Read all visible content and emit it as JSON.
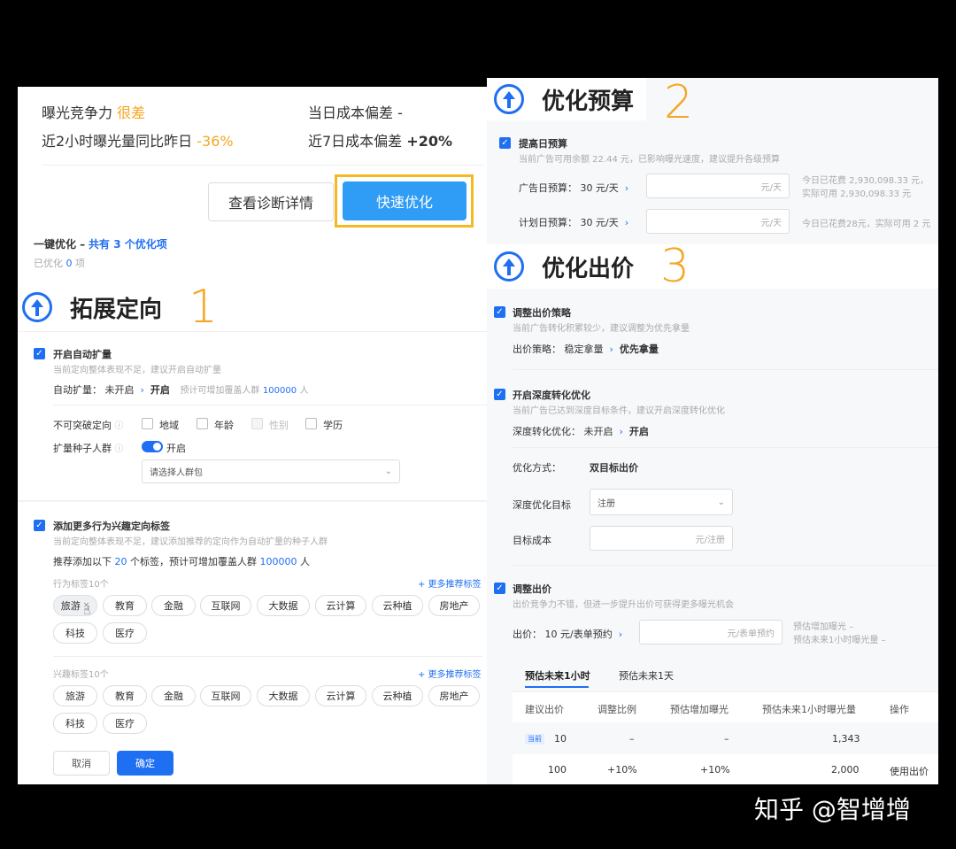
{
  "top_panel": {
    "exposure_label": "曝光竞争力",
    "exposure_value": "很差",
    "cost_dev_label": "当日成本偏差",
    "cost_dev_value": "-",
    "exposure_2h_label": "近2小时曝光量同比昨日",
    "exposure_2h_value": "-36%",
    "cost_7d_label": "近7日成本偏差",
    "cost_7d_value": "+20%",
    "detail_button": "查看诊断详情",
    "quick_button": "快速优化",
    "one_click_label": "一键优化 –",
    "one_click_count": "共有 3 个优化项",
    "optimized_prefix": "已优化",
    "optimized_count": "0",
    "optimized_suffix": "项"
  },
  "section1": {
    "title": "拓展定向",
    "number": "1",
    "auto_expand_title": "开启自动扩量",
    "auto_expand_desc": "当前定向整体表现不足，建议开启自动扩量",
    "auto_expand_label": "自动扩量：",
    "auto_expand_from": "未开启",
    "auto_expand_to": "开启",
    "auto_expand_est_prefix": "预计可增加覆盖人群",
    "auto_expand_est_value": "100000",
    "auto_expand_est_suffix": "人",
    "unbreakable_label": "不可突破定向",
    "unbreak_options": [
      "地域",
      "年龄",
      "性别",
      "学历"
    ],
    "seed_label": "扩量种子人群",
    "seed_toggle": "开启",
    "seed_select_placeholder": "请选择人群包",
    "add_tags_title": "添加更多行为兴趣定向标签",
    "add_tags_desc": "当前定向整体表现不足，建议添加推荐的定向作为自动扩量的种子人群",
    "recommend_prefix": "推荐添加以下",
    "recommend_count": "20",
    "recommend_mid": "个标签，预计可增加覆盖人群",
    "recommend_value": "100000",
    "recommend_suffix": "人",
    "behavior_label": "行为标签10个",
    "more_tags_1": "+ 更多推荐标签",
    "behavior_tags": [
      "旅游",
      "教育",
      "金融",
      "互联网",
      "大数据",
      "云计算",
      "云种植",
      "房地产",
      "科技",
      "医疗"
    ],
    "interest_label": "兴趣标签10个",
    "more_tags_2": "+ 更多推荐标签",
    "interest_tags": [
      "旅游",
      "教育",
      "金融",
      "互联网",
      "大数据",
      "云计算",
      "云种植",
      "房地产",
      "科技",
      "医疗"
    ],
    "cancel_button": "取消",
    "confirm_button": "确定"
  },
  "section2": {
    "title": "优化预算",
    "number": "2",
    "raise_title": "提高日预算",
    "raise_desc": "当前广告可用余额 22.44 元，已影响曝光速度，建议提升各级预算",
    "ad_budget_label": "广告日预算：",
    "ad_budget_value": "30 元/天",
    "ad_budget_unit": "元/天",
    "ad_spent_line": "今日已花费 2,930,098.33 元，",
    "ad_avail_line": "实际可用 2,930,098.33 元",
    "plan_budget_label": "计划日预算：",
    "plan_budget_value": "30 元/天",
    "plan_budget_unit": "元/天",
    "plan_info": "今日已花费28元，实际可用 2 元"
  },
  "section3": {
    "title": "优化出价",
    "number": "3",
    "strategy_title": "调整出价策略",
    "strategy_desc": "当前广告转化积累较少，建议调整为优先拿量",
    "strategy_label": "出价策略：",
    "strategy_from": "稳定拿量",
    "strategy_to": "优先拿量",
    "deep_title": "开启深度转化优化",
    "deep_desc": "当前广告已达到深度目标条件，建议开启深度转化优化",
    "deep_label": "深度转化优化：",
    "deep_from": "未开启",
    "deep_to": "开启",
    "method_label": "优化方式：",
    "method_value": "双目标出价",
    "target_label": "深度优化目标",
    "target_value": "注册",
    "cost_label": "目标成本",
    "cost_unit": "元/注册",
    "bid_title": "调整出价",
    "bid_desc": "出价竞争力不错，但进一步提升出价可获得更多曝光机会",
    "bid_label": "出价：",
    "bid_value": "10 元/表单预约",
    "bid_unit": "元/表单预约",
    "est_inc_label": "预估增加曝光",
    "est_inc_value": "–",
    "est_1h_label": "预估未来1小时曝光量",
    "est_1h_value": "–",
    "tabs": [
      "预估未来1小时",
      "预估未来1天"
    ],
    "table_headers": [
      "建议出价",
      "调整比例",
      "预估增加曝光",
      "预估未来1小时曝光量",
      "操作"
    ],
    "current_badge": "当前",
    "rows": [
      {
        "bid": "10",
        "ratio": "–",
        "inc": "–",
        "exposure": "1,343",
        "action": ""
      },
      {
        "bid": "100",
        "ratio": "+10%",
        "inc": "+10%",
        "exposure": "2,000",
        "action": "使用出价"
      }
    ]
  },
  "watermark": "知乎 @智增增",
  "colors": {
    "accent": "#1f6ff2",
    "warning": "#f5a623",
    "quick_button": "#2f9cf5"
  }
}
